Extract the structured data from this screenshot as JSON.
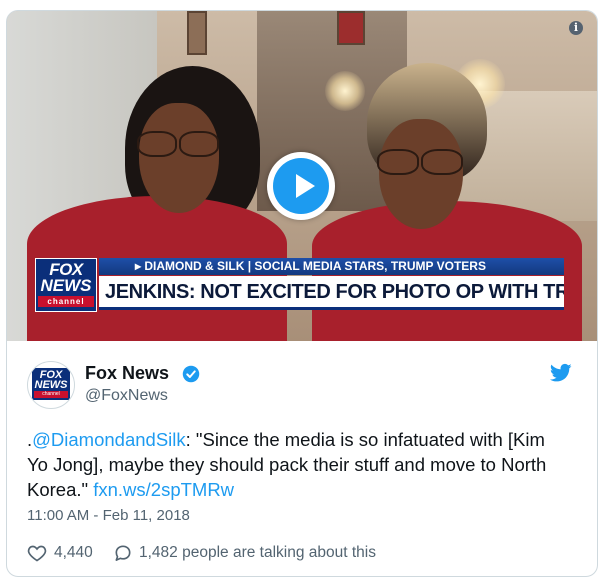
{
  "video": {
    "chyron": {
      "logo_fox": "FOX",
      "logo_news": "NEWS",
      "logo_channel": "channel",
      "top_line": "▸ DIAMOND & SILK | SOCIAL MEDIA STARS, TRUMP VOTERS",
      "headline": "JENKINS: NOT EXCITED FOR PHOTO OP WITH TRUMP"
    },
    "play_icon": "play-icon",
    "info_glyph": "i"
  },
  "tweet": {
    "author_name": "Fox News",
    "author_handle": "@FoxNews",
    "avatar_text": {
      "fox": "FOX",
      "news": "NEWS",
      "channel": "channel"
    },
    "text_prefix": ".",
    "mention": "@DiamondandSilk",
    "text_body": ": \"Since the media is so infatuated with [Kim Yo Jong], maybe they should pack their stuff and move to North Korea.\" ",
    "link": "fxn.ws/2spTMRw",
    "timestamp": "11:00 AM - Feb 11, 2018",
    "likes": "4,440",
    "talking": "1,482 people are talking about this"
  },
  "colors": {
    "twitter_blue": "#1d9bf0",
    "fox_blue": "#0b2f7a",
    "fox_red": "#c8102e",
    "text_primary": "#0f1419",
    "text_secondary": "#536471"
  }
}
